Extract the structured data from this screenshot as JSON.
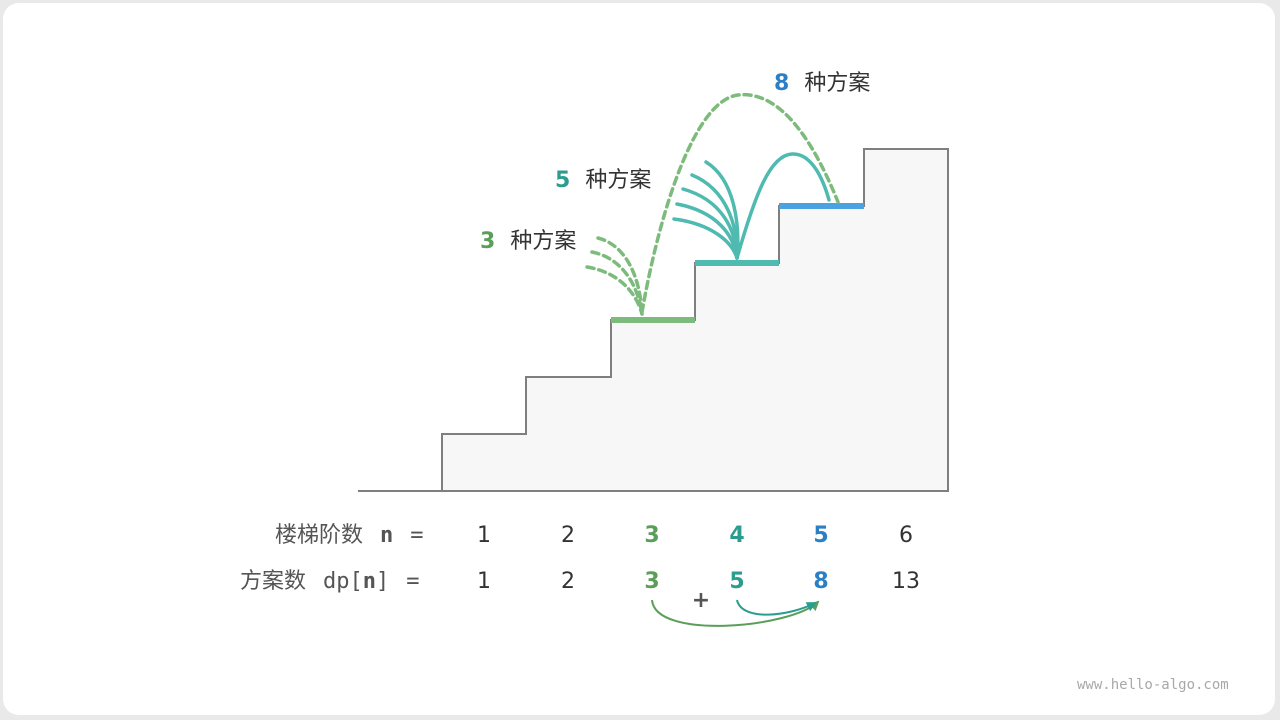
{
  "colors": {
    "green": "#5a9e5a",
    "teal": "#2a9d8f",
    "blue": "#2b7fc4",
    "stair_green": "#7cbb7c",
    "stair_teal": "#4fbab0",
    "stair_blue": "#4aa3e0",
    "text": "#333333",
    "label": "#555555"
  },
  "annotations": [
    {
      "count": "3",
      "text": "种方案"
    },
    {
      "count": "5",
      "text": "种方案"
    },
    {
      "count": "8",
      "text": "种方案"
    }
  ],
  "table": {
    "row1_label": "楼梯阶数",
    "row1_var": "n",
    "row2_label": "方案数",
    "row2_var_prefix": "dp[",
    "row2_var": "n",
    "row2_var_suffix": "]",
    "equals": "=",
    "steps": [
      "1",
      "2",
      "3",
      "4",
      "5",
      "6"
    ],
    "ways": [
      "1",
      "2",
      "3",
      "5",
      "8",
      "13"
    ],
    "plus": "+"
  },
  "watermark": "www.hello-algo.com"
}
